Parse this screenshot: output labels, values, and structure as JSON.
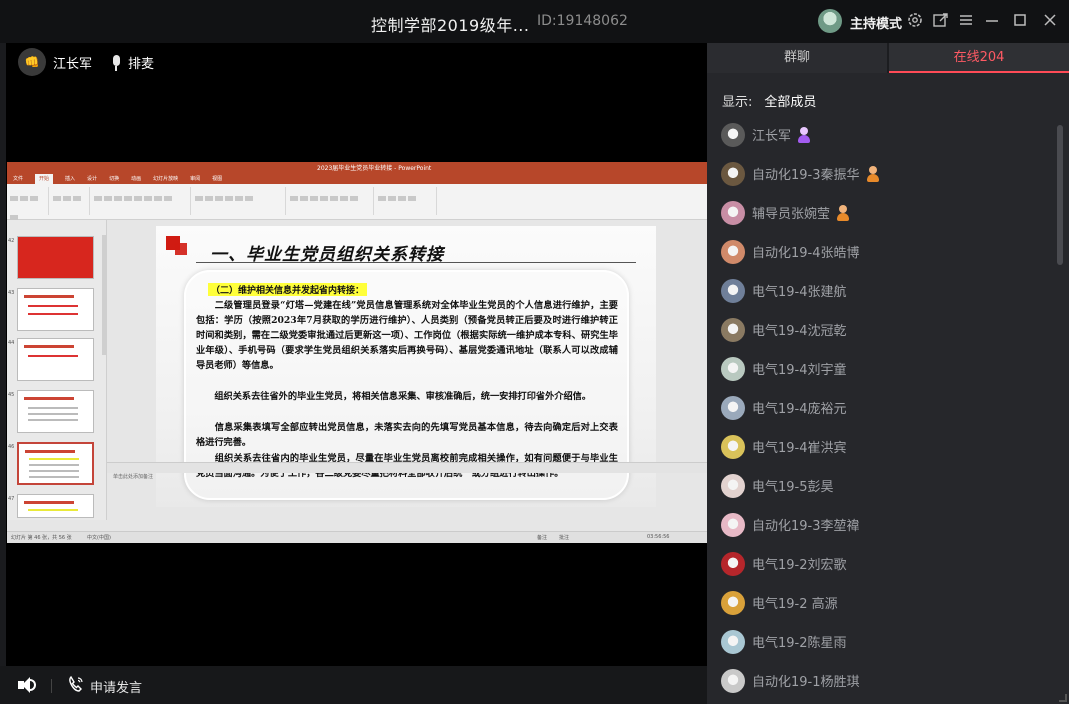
{
  "titlebar": {
    "title": "控制学部2019级年...",
    "meeting_id": "ID:19148062",
    "host_mode": "主持模式"
  },
  "icons": {
    "settings": "gear-icon",
    "popout": "external-link-icon",
    "menu": "hamburger-icon",
    "minimize": "minimize-icon",
    "maximize": "maximize-icon",
    "close": "close-icon"
  },
  "stage": {
    "speaker_name": "江长军",
    "speaker_badge": "👊",
    "mic_label": "排麦"
  },
  "ppt": {
    "window_title": "2023届毕业生党员毕业转接 - PowerPoint",
    "menus": [
      "文件",
      "开始",
      "插入",
      "设计",
      "切换",
      "动画",
      "幻灯片放映",
      "审阅",
      "视图"
    ],
    "active_menu": "开始",
    "thumb_numbers": [
      "42",
      "43",
      "44",
      "45",
      "46",
      "47"
    ],
    "slide": {
      "heading": "一、毕业生党员组织关系转接",
      "subheading": "（二）维护相关信息并发起省内转接：",
      "paragraphs": [
        "　　二级管理员登录“灯塔—党建在线”党员信息管理系统对全体毕业生党员的个人信息进行维护，主要包括：学历（按照2023年7月获取的学历进行维护）、人员类别（预备党员转正后要及时进行维护转正时间和类别，需在二级党委审批通过后更新这一项）、工作岗位（根据实际统一维护成本专科、研究生毕业年级）、手机号码（要求学生党员组织关系落实后再换号码）、基层党委通讯地址（联系人可以改成辅导员老师）等信息。",
        "　　组织关系去往省外的毕业生党员，将相关信息采集、审核准确后，统一安排打印省外介绍信。",
        "　　信息采集表填写全部应转出党员信息，未落实去向的先填写党员基本信息，待去向确定后对上交表格进行完善。",
        "　　组织关系去往省内的毕业生党员，尽量在毕业生党员离校前完成相关操作，如有问题便于与毕业生党员当面沟通。为便于工作，各二级党委尽量把材料全部收齐后统一或分组进行转出操作。"
      ]
    },
    "notes_placeholder": "单击此处添加备注",
    "status_left": "幻灯片 第 46 张，共 56 张",
    "status_lang": "中文(中国)",
    "status_notes": "备注",
    "status_comments": "批注",
    "status_zoom": "03:56:56"
  },
  "bottombar": {
    "speak_label": "申请发言"
  },
  "panel": {
    "tabs": [
      "群聊",
      "在线204"
    ],
    "active_tab": 1,
    "filter_label": "显示:",
    "filter_value": "全部成员",
    "members": [
      {
        "name": "江长军",
        "badge": "host",
        "avatar": "#5a5a5a"
      },
      {
        "name": "自动化19-3秦振华",
        "badge": "admin",
        "avatar": "#6b5840"
      },
      {
        "name": "辅导员张婉莹",
        "badge": "admin",
        "avatar": "#c88ea5"
      },
      {
        "name": "自动化19-4张皓博",
        "badge": "",
        "avatar": "#d08a6a"
      },
      {
        "name": "电气19-4张建航",
        "badge": "",
        "avatar": "#6f7f99"
      },
      {
        "name": "电气19-4沈冠乾",
        "badge": "",
        "avatar": "#8a7a62"
      },
      {
        "name": "电气19-4刘宇童",
        "badge": "",
        "avatar": "#b9c9c0"
      },
      {
        "name": "电气19-4庞裕元",
        "badge": "",
        "avatar": "#9aa9bb"
      },
      {
        "name": "电气19-4崔洪宾",
        "badge": "",
        "avatar": "#d9c25a"
      },
      {
        "name": "电气19-5彭昊",
        "badge": "",
        "avatar": "#e2d2cf"
      },
      {
        "name": "自动化19-3李堃禕",
        "badge": "",
        "avatar": "#e7b9c6"
      },
      {
        "name": "电气19-2刘宏歌",
        "badge": "",
        "avatar": "#b5262b"
      },
      {
        "name": "电气19-2 高源",
        "badge": "",
        "avatar": "#d9a13a"
      },
      {
        "name": "电气19-2陈星雨",
        "badge": "",
        "avatar": "#a9c7d3"
      },
      {
        "name": "自动化19-1杨胜琪",
        "badge": "",
        "avatar": "#c9c9c9"
      }
    ]
  }
}
